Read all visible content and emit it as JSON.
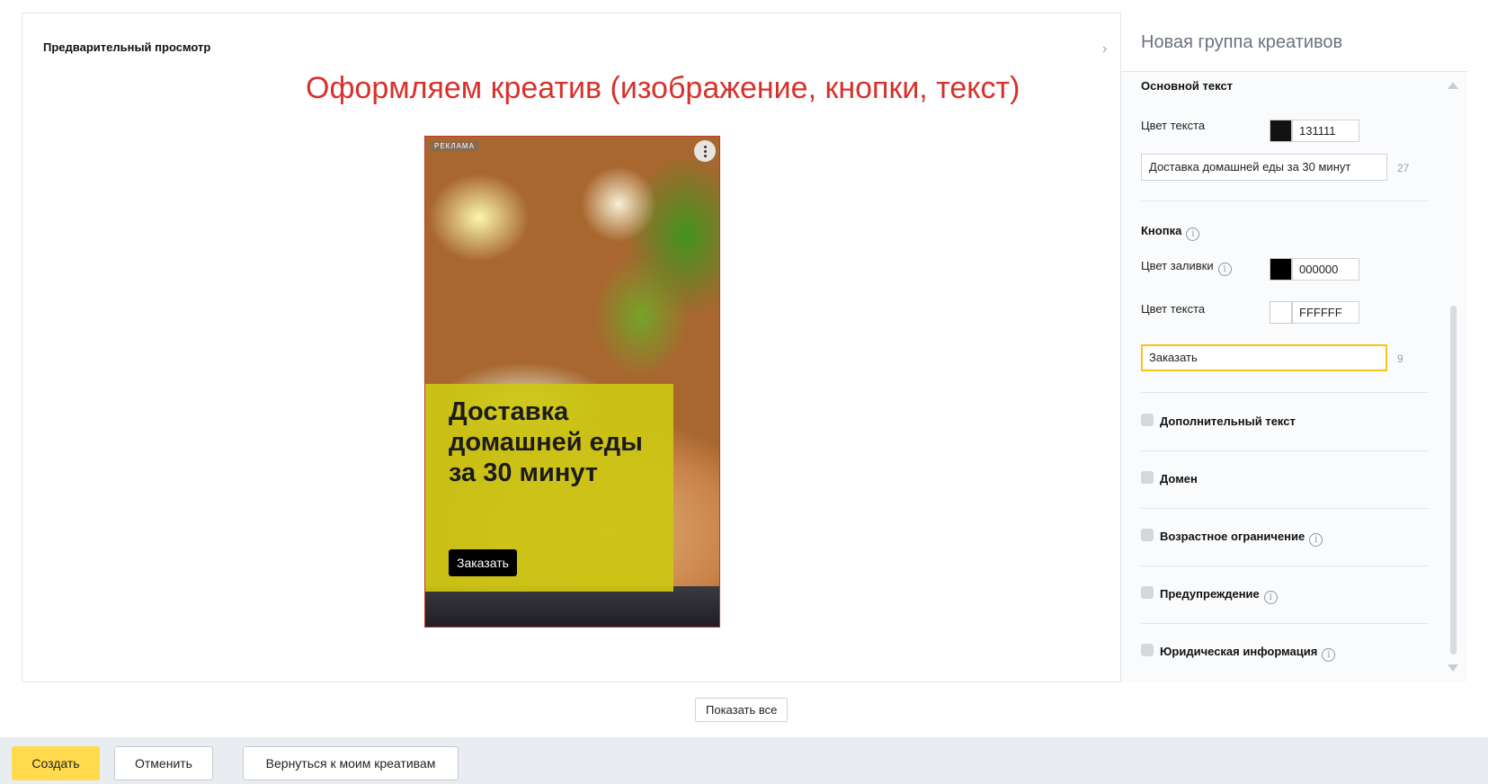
{
  "preview": {
    "title": "Предварительный просмотр",
    "annotation": "Оформляем креатив (изображение, кнопки, текст)",
    "collapse_icon": "chevron-right-icon"
  },
  "creative": {
    "ad_badge": "РЕКЛАМА",
    "headline": "Доставка домашней еды за 30 минут",
    "button_label": "Заказать",
    "overlay_color": "#CCC612",
    "menu_icon": "more-vertical-icon"
  },
  "panel": {
    "title": "Новая группа креативов",
    "main_text": {
      "section_label": "Основной текст",
      "color_label": "Цвет текста",
      "color_hex": "131111",
      "color_value": "#131111",
      "text_value": "Доставка домашней еды за 30 минут",
      "counter": "27"
    },
    "button": {
      "section_label": "Кнопка",
      "fill_label": "Цвет заливки",
      "fill_hex": "000000",
      "fill_value": "#000000",
      "text_color_label": "Цвет текста",
      "text_color_hex": "FFFFFF",
      "text_color_value": "#FFFFFF",
      "text_value": "Заказать",
      "counter": "9"
    },
    "options": [
      {
        "label": "Дополнительный текст",
        "checked": false,
        "info": false
      },
      {
        "label": "Домен",
        "checked": false,
        "info": false
      },
      {
        "label": "Возрастное ограничение",
        "checked": false,
        "info": true
      },
      {
        "label": "Предупреждение",
        "checked": false,
        "info": true
      },
      {
        "label": "Юридическая информация",
        "checked": false,
        "info": true
      }
    ],
    "info_glyph": "i"
  },
  "show_all_label": "Показать все",
  "footer": {
    "create_label": "Создать",
    "cancel_label": "Отменить",
    "back_label": "Вернуться к моим креативам",
    "accent_color": "#FFDB4D"
  }
}
